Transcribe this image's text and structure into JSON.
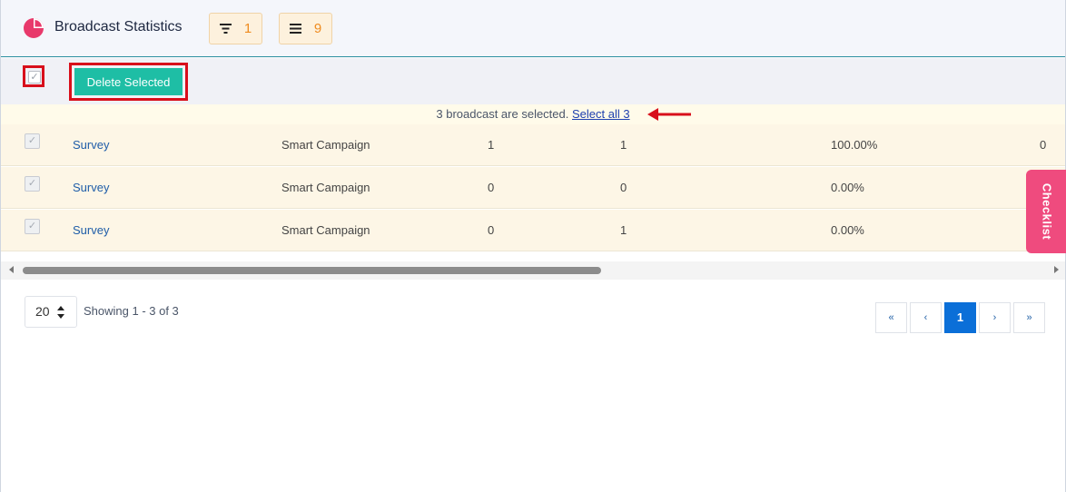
{
  "header": {
    "title": "Broadcast Statistics",
    "filter_count": "1",
    "columns_count": "9",
    "filter_icon": "filter-icon",
    "list_icon": "list-icon",
    "logo_icon": "pie-chart-icon"
  },
  "toolbar": {
    "delete_label": "Delete Selected",
    "master_checked": true
  },
  "selection_notice": {
    "text": "3 broadcast are selected.",
    "link": "Select all 3"
  },
  "rows": [
    {
      "name": "Survey",
      "type": "Smart Campaign",
      "col1": "1",
      "col2": "1",
      "rate": "100.00%",
      "col4": "0",
      "checked": true
    },
    {
      "name": "Survey",
      "type": "Smart Campaign",
      "col1": "0",
      "col2": "0",
      "rate": "0.00%",
      "col4": "",
      "checked": true
    },
    {
      "name": "Survey",
      "type": "Smart Campaign",
      "col1": "0",
      "col2": "1",
      "rate": "0.00%",
      "col4": "",
      "checked": true
    }
  ],
  "checklist_label": "Checklist",
  "footer": {
    "per_page": "20",
    "showing": "Showing 1 - 3 of 3",
    "pagination": {
      "first": "«",
      "prev": "‹",
      "current": "1",
      "next": "›",
      "last": "»"
    }
  },
  "colors": {
    "accent": "#1ebea5",
    "highlight": "#d80f1b",
    "active_page": "#0b6fd8",
    "checklist": "#ef4b7e",
    "chip_text": "#ef8b1f"
  }
}
